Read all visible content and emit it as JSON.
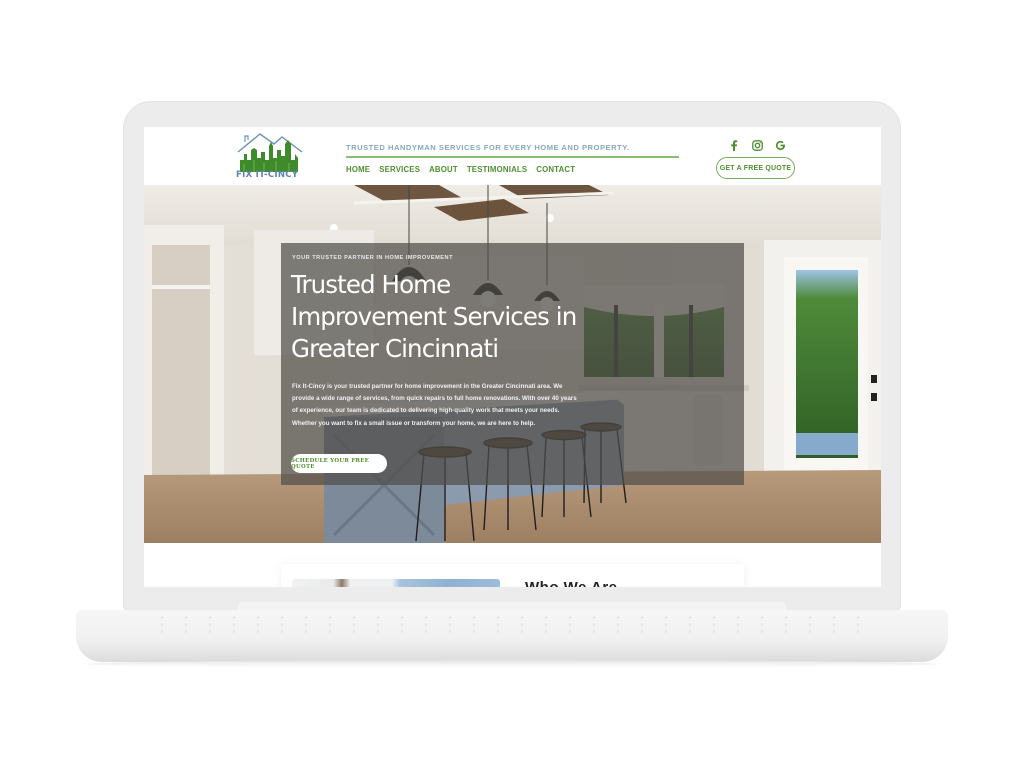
{
  "site": {
    "logo_text": "FIX IT-CINCY",
    "tagline": "TRUSTED HANDYMAN SERVICES FOR EVERY HOME AND PROPERTY.",
    "nav": [
      {
        "label": "HOME"
      },
      {
        "label": "SERVICES"
      },
      {
        "label": "ABOUT"
      },
      {
        "label": "TESTIMONIALS"
      },
      {
        "label": "CONTACT"
      }
    ],
    "social": [
      {
        "icon": "facebook-icon",
        "glyph": "f"
      },
      {
        "icon": "instagram-icon",
        "glyph": "◎"
      },
      {
        "icon": "google-icon",
        "glyph": "G"
      }
    ],
    "quote_button": "GET A FREE QUOTE"
  },
  "hero": {
    "eyebrow": "YOUR TRUSTED PARTNER IN HOME IMPROVEMENT",
    "title": "Trusted Home Improvement Services in Greater Cincinnati",
    "copy": "Fix It-Cincy is your trusted partner for home improvement in the Greater Cincinnati area. We provide a wide range of services, from quick repairs to full home renovations. With over 40 years of experience, our team is dedicated to delivering high-quality work that meets your needs. Whether you want to fix a small issue or transform your home, we are here to help.",
    "cta": "SCHEDULE YOUR FREE QUOTE"
  },
  "about": {
    "heading": "Who We Are"
  },
  "colors": {
    "brand_green": "#4f8f2f",
    "tagline_blue": "#8aa8bd",
    "logo_blue": "#5b86a8"
  }
}
